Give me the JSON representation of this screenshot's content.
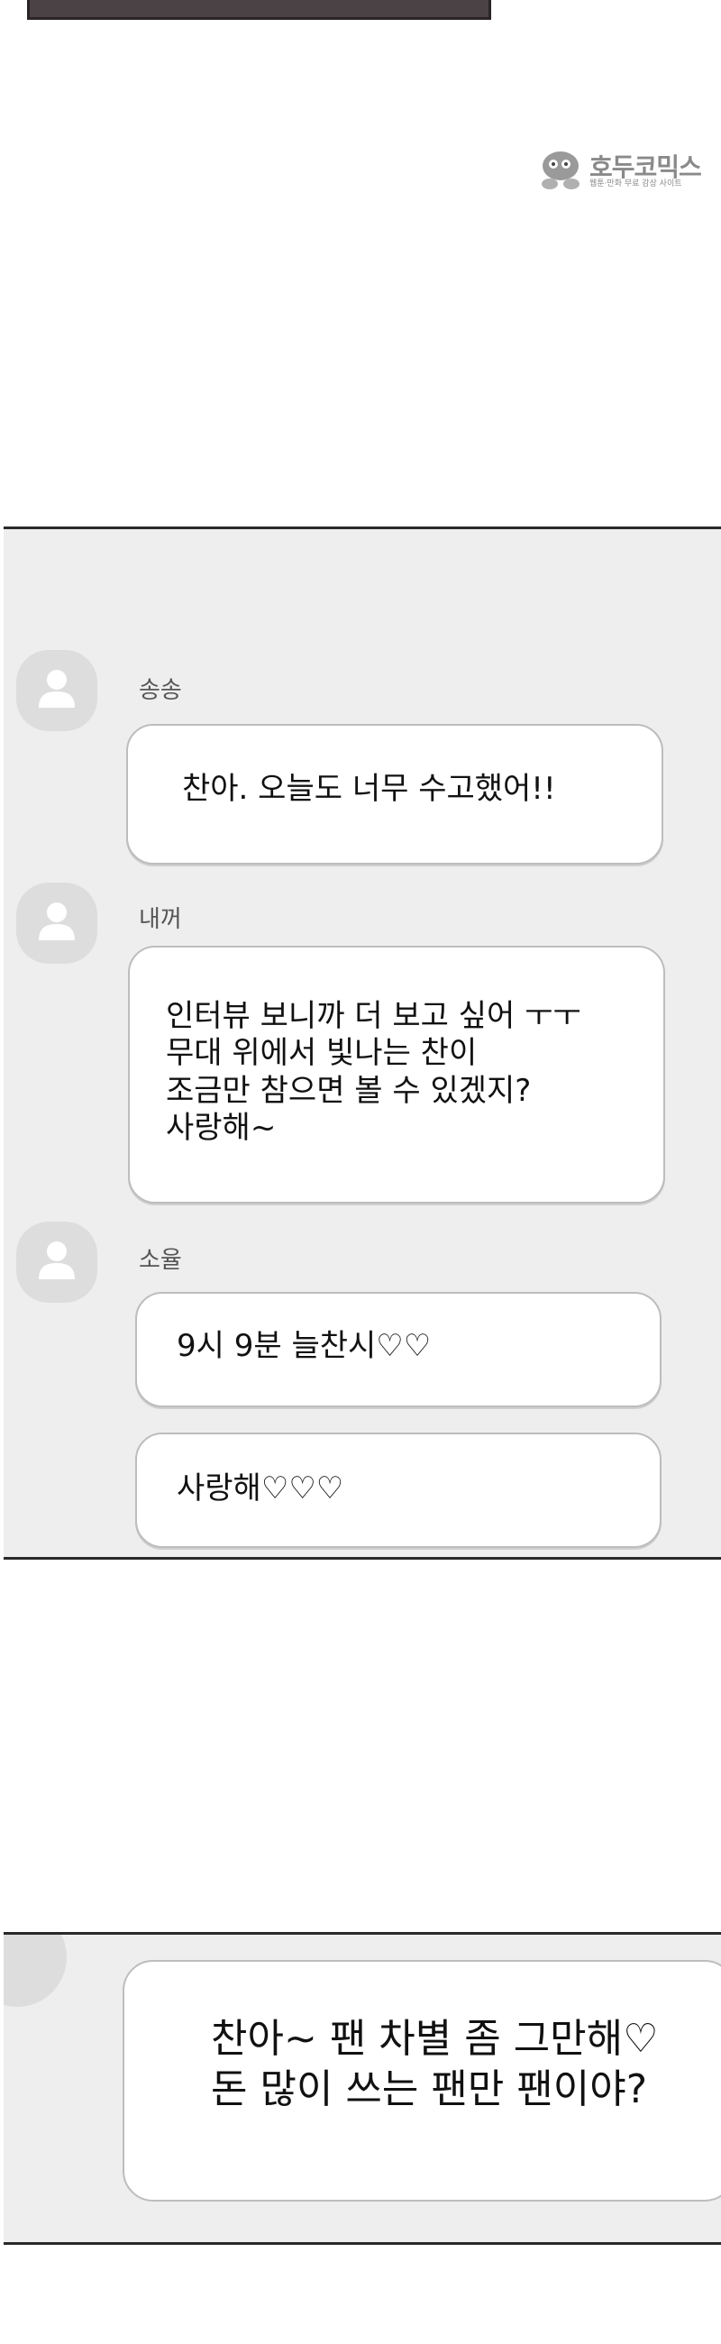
{
  "watermark": {
    "title": "호두코믹스",
    "subtitle": "웹툰·만화 무료 감상 사이트"
  },
  "chat": {
    "messages": [
      {
        "sender": "송송",
        "lines": [
          "찬아. 오늘도 너무 수고했어!!"
        ]
      },
      {
        "sender": "내꺼",
        "lines": [
          "인터뷰 보니까 더 보고 싶어 ㅜㅜ",
          "무대 위에서 빛나는 찬이",
          "조금만 참으면 볼 수 있겠지?",
          "사랑해~"
        ]
      },
      {
        "sender": "소율",
        "lines": [
          "9시 9분 늘찬시♡♡"
        ]
      },
      {
        "sender": "",
        "lines": [
          "사랑해♡♡♡"
        ]
      }
    ]
  },
  "chat2": {
    "lines": [
      "찬아~ 팬 차별 좀 그만해♡",
      "돈 많이 쓰는 팬만 팬이야?"
    ]
  },
  "icons": {
    "avatar": "person-icon"
  }
}
